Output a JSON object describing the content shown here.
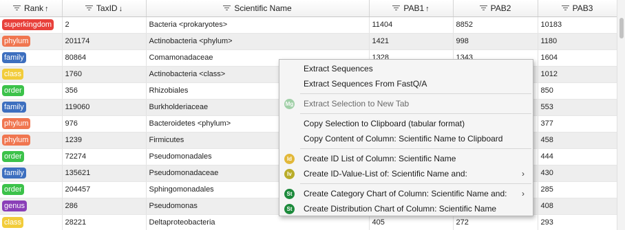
{
  "columns": [
    {
      "label": "Rank",
      "sort": "↑"
    },
    {
      "label": "TaxID",
      "sort": "↓"
    },
    {
      "label": "Scientific Name",
      "sort": ""
    },
    {
      "label": "PAB1",
      "sort": "↑"
    },
    {
      "label": "PAB2",
      "sort": ""
    },
    {
      "label": "PAB3",
      "sort": ""
    }
  ],
  "rank_colors": {
    "superkingdom": "#e8413b",
    "phylum": "#f07650",
    "family": "#3d6fbf",
    "class": "#f2cc3a",
    "order": "#3cc24a",
    "genus": "#8a3fb8"
  },
  "rows": [
    {
      "rank": "superkingdom",
      "taxid": "2",
      "name": "Bacteria <prokaryotes>",
      "pab1": "11404",
      "pab2": "8852",
      "pab3": "10183"
    },
    {
      "rank": "phylum",
      "taxid": "201174",
      "name": "Actinobacteria <phylum>",
      "pab1": "1421",
      "pab2": "998",
      "pab3": "1180"
    },
    {
      "rank": "family",
      "taxid": "80864",
      "name": "Comamonadaceae",
      "pab1": "1328",
      "pab2": "1343",
      "pab3": "1604"
    },
    {
      "rank": "class",
      "taxid": "1760",
      "name": "Actinobacteria <class>",
      "pab1": "",
      "pab2": "",
      "pab3": "1012"
    },
    {
      "rank": "order",
      "taxid": "356",
      "name": "Rhizobiales",
      "pab1": "",
      "pab2": "",
      "pab3": "850"
    },
    {
      "rank": "family",
      "taxid": "119060",
      "name": "Burkholderiaceae",
      "pab1": "",
      "pab2": "",
      "pab3": "553"
    },
    {
      "rank": "phylum",
      "taxid": "976",
      "name": "Bacteroidetes <phylum>",
      "pab1": "",
      "pab2": "",
      "pab3": "377"
    },
    {
      "rank": "phylum",
      "taxid": "1239",
      "name": "Firmicutes",
      "pab1": "",
      "pab2": "",
      "pab3": "458"
    },
    {
      "rank": "order",
      "taxid": "72274",
      "name": "Pseudomonadales",
      "pab1": "",
      "pab2": "",
      "pab3": "444"
    },
    {
      "rank": "family",
      "taxid": "135621",
      "name": "Pseudomonadaceae",
      "pab1": "",
      "pab2": "",
      "pab3": "430"
    },
    {
      "rank": "order",
      "taxid": "204457",
      "name": "Sphingomonadales",
      "pab1": "",
      "pab2": "",
      "pab3": "285"
    },
    {
      "rank": "genus",
      "taxid": "286",
      "name": "Pseudomonas",
      "pab1": "",
      "pab2": "",
      "pab3": "408"
    },
    {
      "rank": "class",
      "taxid": "28221",
      "name": "Deltaproteobacteria",
      "pab1": "405",
      "pab2": "272",
      "pab3": "293"
    }
  ],
  "context_menu": {
    "items": [
      {
        "type": "item",
        "label": "Extract Sequences",
        "icon": "",
        "icon_color": "",
        "name": "menu-extract-sequences"
      },
      {
        "type": "item",
        "label": "Extract Sequences From FastQ/A",
        "icon": "",
        "icon_color": "",
        "name": "menu-extract-fastqa"
      },
      {
        "type": "sep"
      },
      {
        "type": "item",
        "label": "Extract Selection to New Tab",
        "icon": "Mg",
        "icon_color": "#3aa54a",
        "faded": true,
        "disabled": true,
        "name": "menu-extract-new-tab"
      },
      {
        "type": "sep"
      },
      {
        "type": "item",
        "label": "Copy Selection to Clipboard (tabular format)",
        "icon": "",
        "icon_color": "",
        "name": "menu-copy-selection"
      },
      {
        "type": "item",
        "label": "Copy Content of Column: Scientific Name to Clipboard",
        "icon": "",
        "icon_color": "",
        "name": "menu-copy-column"
      },
      {
        "type": "sep"
      },
      {
        "type": "item",
        "label": "Create ID List of Column: Scientific Name",
        "icon": "Id",
        "icon_color": "#e2b83a",
        "name": "menu-create-id-list"
      },
      {
        "type": "item",
        "label": "Create ID-Value-List of: Scientific Name and:",
        "icon": "Iv",
        "icon_color": "#b9ad2a",
        "submenu": true,
        "name": "menu-create-id-value-list"
      },
      {
        "type": "sep"
      },
      {
        "type": "item",
        "label": "Create Category Chart of Column: Scientific Name and:",
        "icon": "St",
        "icon_color": "#1d8a3c",
        "submenu": true,
        "name": "menu-create-category-chart"
      },
      {
        "type": "item",
        "label": "Create Distribution Chart of Column: Scientific Name",
        "icon": "St",
        "icon_color": "#1d8a3c",
        "name": "menu-create-distribution-chart"
      }
    ],
    "submenu_arrow": "›"
  }
}
